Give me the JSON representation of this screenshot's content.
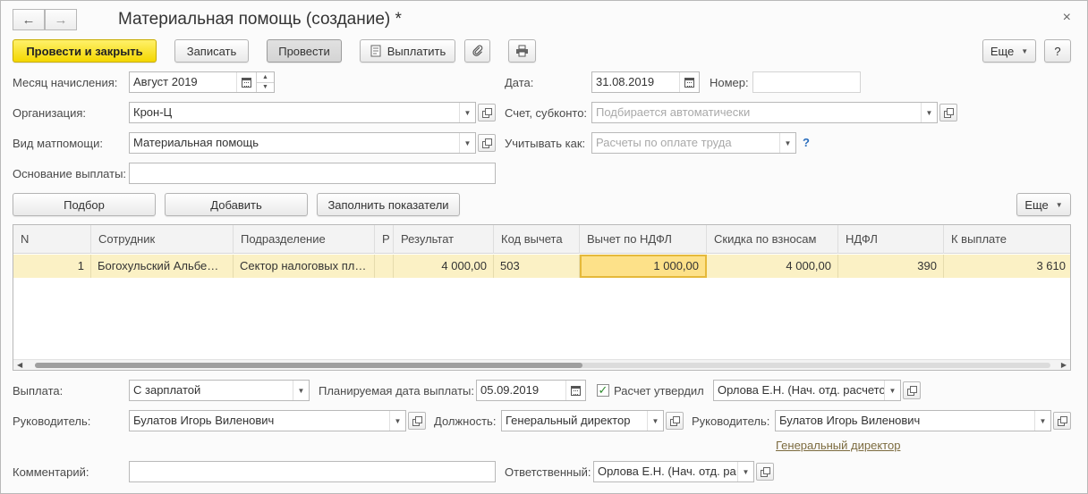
{
  "window": {
    "title": "Материальная помощь (создание) *",
    "back": "←",
    "forward": "→",
    "close": "×"
  },
  "toolbar": {
    "post_close": "Провести и закрыть",
    "save": "Записать",
    "post": "Провести",
    "pay": "Выплатить",
    "more": "Еще",
    "help": "?"
  },
  "header": {
    "month_label": "Месяц начисления:",
    "month_value": "Август 2019",
    "date_label": "Дата:",
    "date_value": "31.08.2019",
    "number_label": "Номер:",
    "number_value": "",
    "org_label": "Организация:",
    "org_value": "Крон-Ц",
    "account_label": "Счет, субконто:",
    "account_placeholder": "Подбирается автоматически",
    "type_label": "Вид матпомощи:",
    "type_value": "Материальная помощь",
    "accountas_label": "Учитывать как:",
    "accountas_placeholder": "Расчеты по оплате труда",
    "accountas_help": "?",
    "basis_label": "Основание выплаты:",
    "basis_value": ""
  },
  "table_toolbar": {
    "pick": "Подбор",
    "add": "Добавить",
    "fill": "Заполнить показатели",
    "more": "Еще"
  },
  "table": {
    "columns": [
      "N",
      "Сотрудник",
      "Подразделение",
      "Р",
      "Результат",
      "Код вычета",
      "Вычет по НДФЛ",
      "Скидка по взносам",
      "НДФЛ",
      "К выплате"
    ],
    "rows": [
      [
        "1",
        "Богохульский Альбе…",
        "Сектор налоговых пл…",
        "",
        "4 000,00",
        "503",
        "1 000,00",
        "4 000,00",
        "390",
        "3 610"
      ]
    ]
  },
  "footer": {
    "payout_label": "Выплата:",
    "payout_value": "С зарплатой",
    "planned_date_label": "Планируемая дата выплаты:",
    "planned_date_value": "05.09.2019",
    "approved_label": "Расчет утвердил",
    "approved_checked": "✓",
    "approved_value": "Орлова Е.Н. (Нач. отд. расчетов",
    "manager_label": "Руководитель:",
    "manager_value": "Булатов Игорь Виленович",
    "position_label": "Должность:",
    "position_value": "Генеральный директор",
    "manager2_label": "Руководитель:",
    "manager2_value": "Булатов Игорь Виленович",
    "manager2_position_link": "Генеральный директор",
    "comment_label": "Комментарий:",
    "comment_value": "",
    "responsible_label": "Ответственный:",
    "responsible_value": "Орлова Е.Н. (Нач. отд. ра"
  }
}
